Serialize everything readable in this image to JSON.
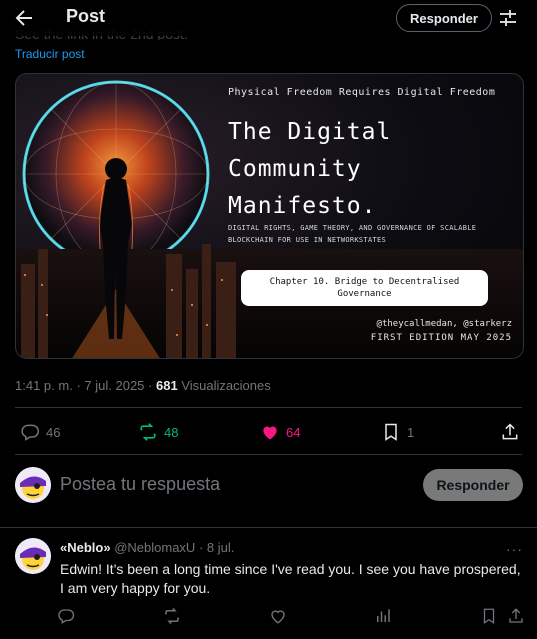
{
  "header": {
    "title": "Post",
    "reply_button": "Responder"
  },
  "post": {
    "ghost_text": "See the link in the 2nd post.",
    "translate_link": "Traducir post",
    "image": {
      "top_line": "Physical Freedom Requires Digital Freedom",
      "title_lines": [
        "The Digital",
        "Community",
        "Manifesto."
      ],
      "subtitle": "DIGITAL RIGHTS, GAME THEORY, AND GOVERNANCE OF SCALABLE BLOCKCHAIN FOR USE IN NETWORKSTATES",
      "chapter": "Chapter 10. Bridge to Decentralised Governance",
      "authors": "@theycallmedan, @starkerz",
      "edition": "FIRST EDITION MAY 2025"
    },
    "time": "1:41 p. m.",
    "date": "7 jul. 2025",
    "separator": "·",
    "views_count": "681",
    "views_label": "Visualizaciones",
    "actions": {
      "replies": "46",
      "reposts": "48",
      "likes": "64",
      "bookmarks": "1"
    },
    "action_colors": {
      "repost": "#00ba7c",
      "like": "#f91880",
      "default": "#71767b"
    }
  },
  "composer": {
    "placeholder": "Postea tu respuesta",
    "button": "Responder"
  },
  "reply": {
    "name": "«Neblo»",
    "handle": "@NeblomaxU",
    "date": "8 jul.",
    "separator": "·",
    "more": "···",
    "text": "Edwin! It's been a long time since I've read you. I see you have prospered, I am very happy for you."
  }
}
